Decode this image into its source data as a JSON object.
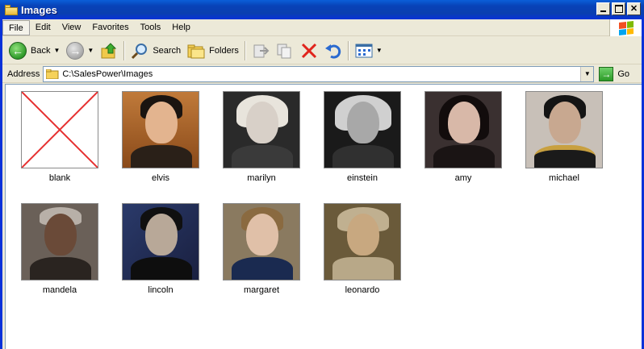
{
  "window": {
    "title": "Images"
  },
  "menu": {
    "items": [
      "File",
      "Edit",
      "View",
      "Favorites",
      "Tools",
      "Help"
    ]
  },
  "toolbar": {
    "back_label": "Back",
    "search_label": "Search",
    "folders_label": "Folders"
  },
  "address": {
    "label": "Address",
    "value": "C:\\SalesPower\\Images",
    "go_label": "Go"
  },
  "files": [
    {
      "name": "blank"
    },
    {
      "name": "elvis"
    },
    {
      "name": "marilyn"
    },
    {
      "name": "einstein"
    },
    {
      "name": "amy"
    },
    {
      "name": "michael"
    },
    {
      "name": "mandela"
    },
    {
      "name": "lincoln"
    },
    {
      "name": "margaret"
    },
    {
      "name": "leonardo"
    }
  ]
}
